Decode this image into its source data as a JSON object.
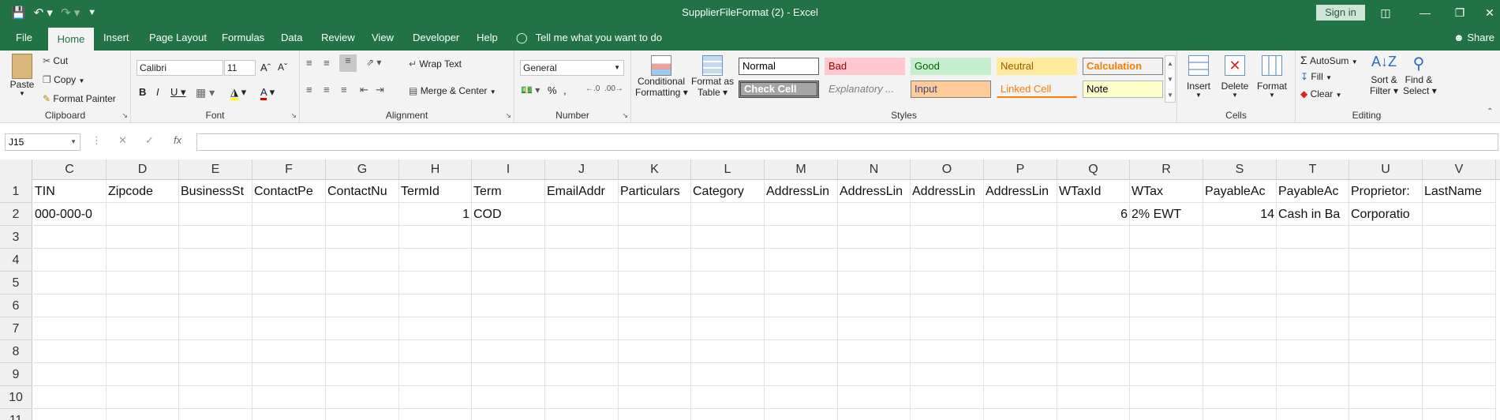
{
  "window": {
    "title": "SupplierFileFormat (2)  -  Excel",
    "signin_label": "Sign in",
    "colors": {
      "brand": "#217346",
      "ribbon": "#f3f3f3"
    }
  },
  "qat": {
    "save_icon": "save-icon",
    "undo_icon": "undo-icon",
    "redo_icon": "redo-icon",
    "customize_icon": "customize-icon"
  },
  "tabs": [
    {
      "label": "File"
    },
    {
      "label": "Home"
    },
    {
      "label": "Insert"
    },
    {
      "label": "Page Layout"
    },
    {
      "label": "Formulas"
    },
    {
      "label": "Data"
    },
    {
      "label": "Review"
    },
    {
      "label": "View"
    },
    {
      "label": "Developer"
    },
    {
      "label": "Help"
    }
  ],
  "tellme": "Tell me what you want to do",
  "share": "Share",
  "ribbon": {
    "clipboard": {
      "label": "Clipboard",
      "paste": "Paste",
      "cut": "Cut",
      "copy": "Copy",
      "format_painter": "Format Painter"
    },
    "font": {
      "label": "Font",
      "family": "Calibri",
      "size": "11"
    },
    "alignment": {
      "label": "Alignment",
      "wrap_text": "Wrap Text",
      "merge_center": "Merge & Center"
    },
    "number": {
      "label": "Number",
      "format": "General"
    },
    "styles": {
      "label": "Styles",
      "conditional": "Conditional",
      "conditional2": "Formatting",
      "format_as": "Format as",
      "format_as2": "Table",
      "normal": "Normal",
      "bad": "Bad",
      "good": "Good",
      "neutral": "Neutral",
      "calculation": "Calculation",
      "check_cell": "Check Cell",
      "explanatory": "Explanatory ...",
      "input": "Input",
      "linked_cell": "Linked Cell",
      "note": "Note"
    },
    "cells": {
      "label": "Cells",
      "insert": "Insert",
      "delete": "Delete",
      "format": "Format"
    },
    "editing": {
      "label": "Editing",
      "autosum": "AutoSum",
      "fill": "Fill",
      "clear": "Clear",
      "sort": "Sort &",
      "sort2": "Filter",
      "find": "Find &",
      "find2": "Select"
    }
  },
  "formula_bar": {
    "name_box": "J15",
    "formula": ""
  },
  "grid": {
    "columns": [
      "C",
      "D",
      "E",
      "F",
      "G",
      "H",
      "I",
      "J",
      "K",
      "L",
      "M",
      "N",
      "O",
      "P",
      "Q",
      "R",
      "S",
      "T",
      "U",
      "V"
    ],
    "rows": [
      "1",
      "2",
      "3",
      "4",
      "5",
      "6",
      "7",
      "8",
      "9",
      "10",
      "11"
    ],
    "row1": [
      "TIN",
      "Zipcode",
      "BusinessSt",
      "ContactPe",
      "ContactNu",
      "TermId",
      "Term",
      "EmailAddr",
      "Particulars",
      "Category",
      "AddressLin",
      "AddressLin",
      "AddressLin",
      "AddressLin",
      "WTaxId",
      "WTax",
      "PayableAc",
      "PayableAc",
      "Proprietor:",
      "LastName"
    ],
    "row2": [
      "000-000-0",
      "",
      "",
      "",
      "",
      "1",
      "COD",
      "",
      "",
      "",
      "",
      "",
      "",
      "",
      "6",
      "2% EWT",
      "14",
      "Cash in Ba",
      "Corporatio",
      ""
    ]
  }
}
